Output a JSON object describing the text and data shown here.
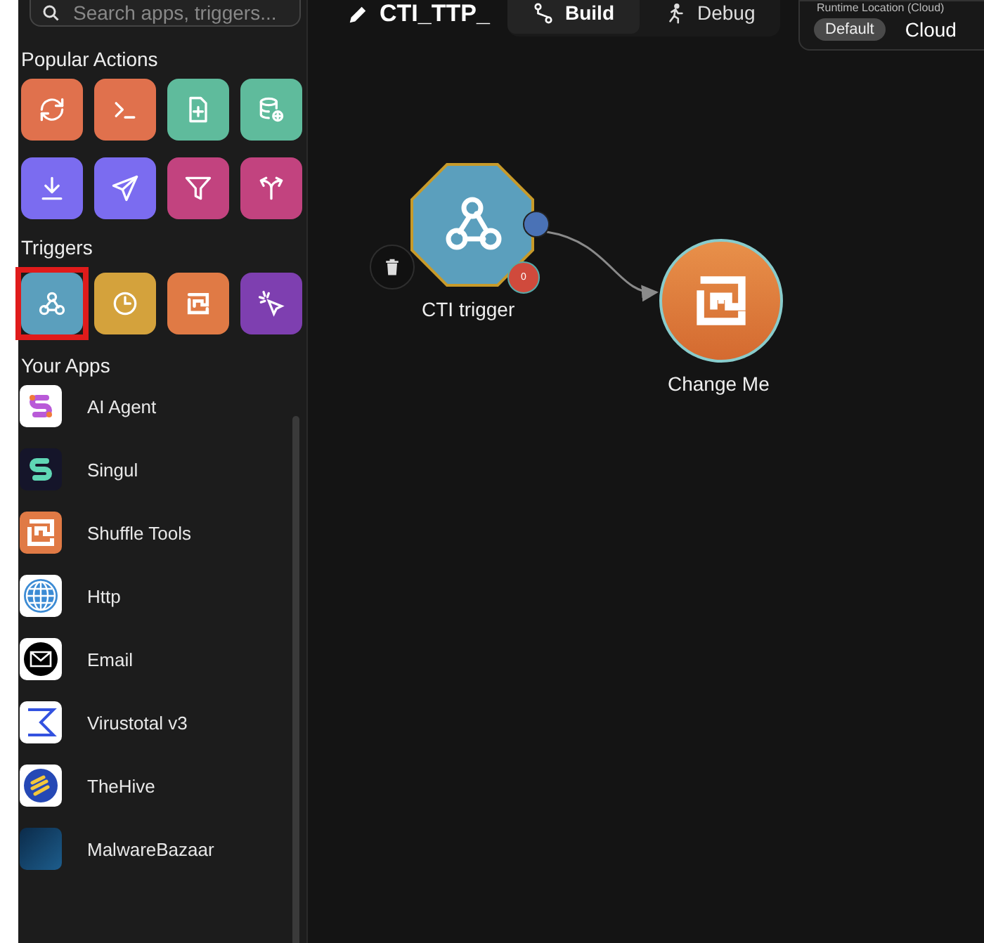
{
  "sidebar": {
    "search": {
      "placeholder": "Search apps, triggers..."
    },
    "popular_actions": {
      "title": "Popular Actions",
      "items": [
        {
          "color": "#e0714d"
        },
        {
          "color": "#e0714d"
        },
        {
          "color": "#5fbb9c"
        },
        {
          "color": "#5fbb9c"
        },
        {
          "color": "#7b6cf0"
        },
        {
          "color": "#7b6cf0"
        },
        {
          "color": "#c2437f"
        },
        {
          "color": "#c2437f"
        }
      ]
    },
    "triggers": {
      "title": "Triggers",
      "items": [
        {
          "color": "#5b9fbd",
          "selected": true
        },
        {
          "color": "#d4a23c",
          "selected": false
        },
        {
          "color": "#e07a45",
          "selected": false
        },
        {
          "color": "#7e3fb0",
          "selected": false
        }
      ]
    },
    "your_apps": {
      "title": "Your Apps",
      "items": [
        {
          "name": "AI Agent"
        },
        {
          "name": "Singul"
        },
        {
          "name": "Shuffle Tools"
        },
        {
          "name": "Http"
        },
        {
          "name": "Email"
        },
        {
          "name": "Virustotal v3"
        },
        {
          "name": "TheHive"
        },
        {
          "name": "MalwareBazaar"
        }
      ]
    }
  },
  "header": {
    "workflow_name": "CTI_TTP_",
    "tabs": [
      {
        "label": "Build",
        "selected": true
      },
      {
        "label": "Debug",
        "selected": false
      }
    ],
    "runtime": {
      "label": "Runtime Location (Cloud)",
      "options": [
        {
          "label": "Default",
          "selected": true
        },
        {
          "label": "Cloud",
          "selected": false
        }
      ]
    }
  },
  "canvas": {
    "trigger_node": {
      "label": "CTI trigger",
      "badge": "0"
    },
    "action_node": {
      "label": "Change Me"
    }
  }
}
